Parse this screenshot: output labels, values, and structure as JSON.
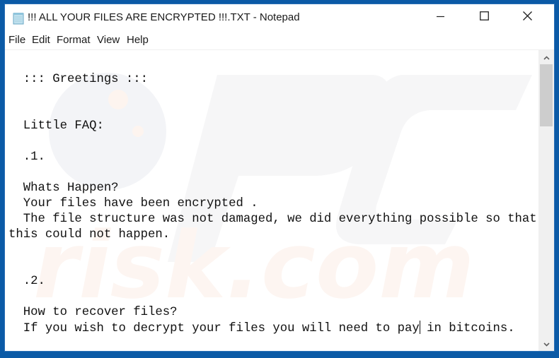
{
  "window": {
    "title": "!!! ALL YOUR FILES ARE ENCRYPTED !!!.TXT - Notepad",
    "app_icon": "notepad-icon",
    "controls": {
      "minimize": "minimize-icon",
      "maximize": "maximize-icon",
      "close": "close-icon"
    }
  },
  "menu": {
    "items": [
      {
        "label": "File"
      },
      {
        "label": "Edit"
      },
      {
        "label": "Format"
      },
      {
        "label": "View"
      },
      {
        "label": "Help"
      }
    ]
  },
  "editor": {
    "lines": [
      "",
      "  ::: Greetings :::",
      "",
      "",
      "  Little FAQ:",
      "",
      "  .1.",
      "",
      "  Whats Happen?",
      "  Your files have been encrypted .",
      "  The file structure was not damaged, we did everything possible so that",
      "this could not happen.",
      "",
      "",
      "  .2.",
      "",
      "  How to recover files?",
      "  If you wish to decrypt your files you will need to pay"
    ],
    "caret_line_rest": " in bitcoins.",
    "watermark": "PC risk.com"
  },
  "scrollbar": {
    "up_icon": "chevron-up-icon",
    "down_icon": "chevron-down-icon",
    "position_fraction": 0.0
  }
}
